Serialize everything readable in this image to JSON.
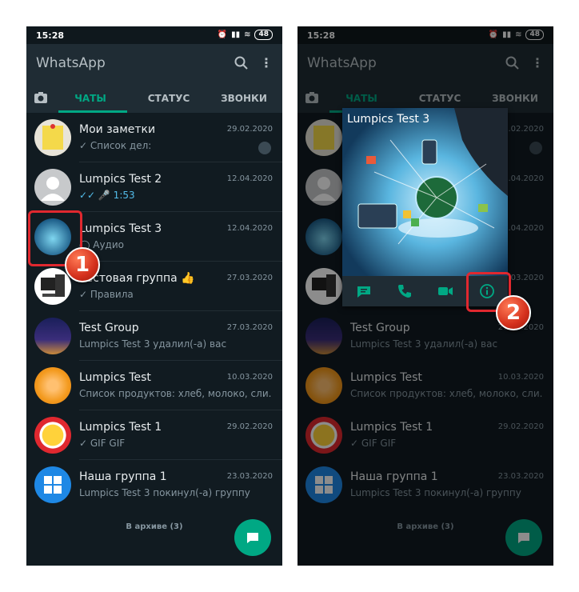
{
  "status_bar": {
    "time": "15:28",
    "battery": "48"
  },
  "app": {
    "title": "WhatsApp"
  },
  "tabs": {
    "chats": "ЧАТЫ",
    "status": "СТАТУС",
    "calls": "ЗВОНКИ"
  },
  "chats": [
    {
      "name": "Мои заметки",
      "date": "29.02.2020",
      "preview": "✓ Список дел:",
      "pinned": true
    },
    {
      "name": "Lumpics Test 2",
      "date": "12.04.2020",
      "preview": "✓✓ 🎤 1:53"
    },
    {
      "name": "Lumpics Test 3",
      "date": "12.04.2020",
      "preview": "◯ Аудио"
    },
    {
      "name": "Тестовая группа 👍",
      "date": "27.03.2020",
      "preview": "✓ Правила"
    },
    {
      "name": "Test Group",
      "date": "27.03.2020",
      "preview": "Lumpics Test 3 удалил(-а) вас"
    },
    {
      "name": "Lumpics Test",
      "date": "10.03.2020",
      "preview": "Список продуктов: хлеб, молоко, сли..."
    },
    {
      "name": "Lumpics Test 1",
      "date": "29.02.2020",
      "preview": "✓ GIF GIF"
    },
    {
      "name": "Наша группа 1",
      "date": "23.03.2020",
      "preview": "Lumpics Test 3 покинул(-а) группу"
    }
  ],
  "archive_label": "В архиве (3)",
  "popup": {
    "name": "Lumpics Test 3"
  },
  "markers": {
    "one": "1",
    "two": "2"
  },
  "colors": {
    "accent": "#00a884",
    "callout": "#e0282f",
    "background": "#111b21"
  }
}
